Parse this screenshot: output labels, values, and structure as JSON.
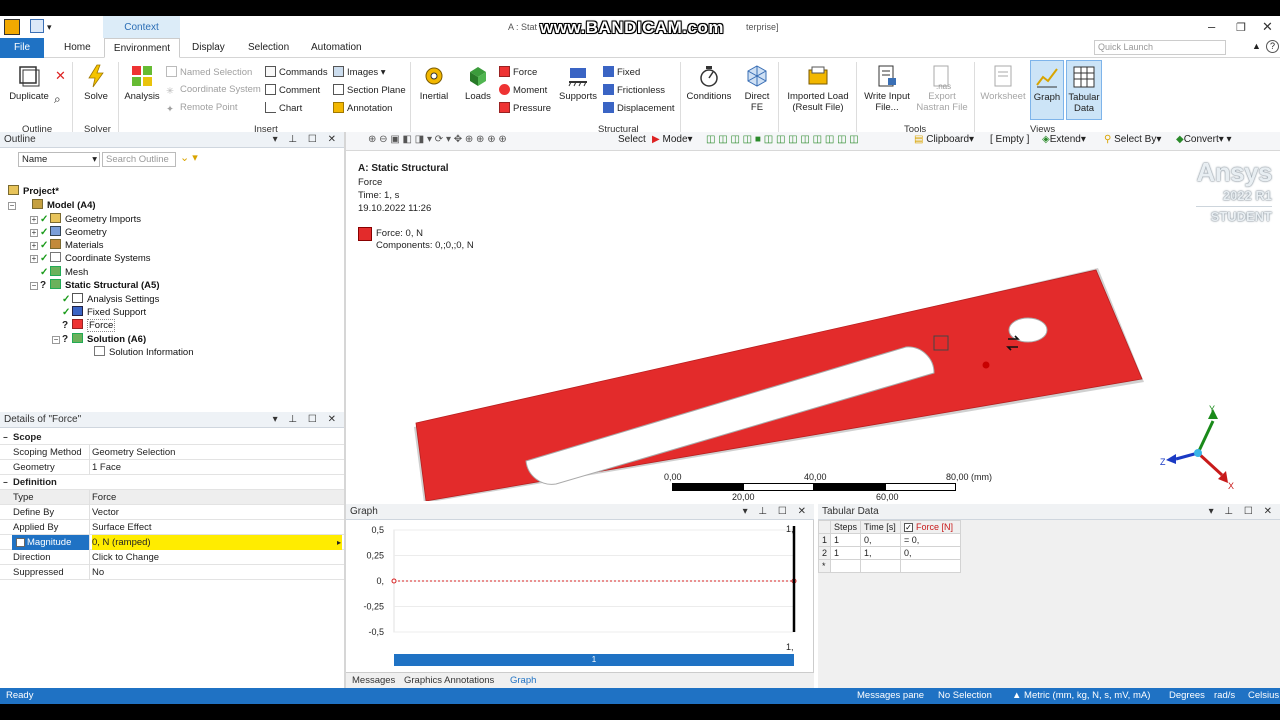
{
  "window": {
    "title": "A : Stat",
    "title_tail": "terprise]",
    "watermark": "www.BANDICAM.com",
    "context_tab": "Context",
    "controls": [
      "–",
      "❐",
      "✕"
    ]
  },
  "menu": {
    "tabs": [
      "File",
      "Home",
      "Environment",
      "Display",
      "Selection",
      "Automation"
    ],
    "active": "Environment",
    "quick_launch_placeholder": "Quick Launch",
    "help": "?"
  },
  "ribbon": {
    "duplicate": "Duplicate",
    "solve": "Solve",
    "analysis": "Analysis",
    "named_selection": "Named Selection",
    "coordinate_system": "Coordinate System",
    "remote_point": "Remote Point",
    "commands": "Commands",
    "comment": "Comment",
    "chart": "Chart",
    "images": "Images",
    "section_plane": "Section Plane",
    "annotation": "Annotation",
    "inertial": "Inertial",
    "loads": "Loads",
    "force": "Force",
    "moment": "Moment",
    "pressure": "Pressure",
    "supports": "Supports",
    "fixed": "Fixed",
    "frictionless": "Frictionless",
    "displacement": "Displacement",
    "conditions": "Conditions",
    "direct_fe_1": "Direct",
    "direct_fe_2": "FE",
    "imported_load_1": "Imported Load",
    "imported_load_2": "(Result File)",
    "write_input_1": "Write Input",
    "write_input_2": "File...",
    "export_nastran_1": "Export",
    "export_nastran_2": "Nastran File",
    "nas_label": ".nas",
    "worksheet": "Worksheet",
    "graph": "Graph",
    "tabular_1": "Tabular",
    "tabular_2": "Data",
    "groups": {
      "outline": "Outline",
      "solver": "Solver",
      "insert": "Insert",
      "structural": "Structural",
      "tools": "Tools",
      "views": "Views"
    }
  },
  "outline": {
    "header": "Outline",
    "filter_name": "Name",
    "search_placeholder": "Search Outline",
    "tree": [
      {
        "label": "Project*"
      },
      {
        "label": "Model (A4)"
      },
      {
        "label": "Geometry Imports"
      },
      {
        "label": "Geometry"
      },
      {
        "label": "Materials"
      },
      {
        "label": "Coordinate Systems"
      },
      {
        "label": "Mesh"
      },
      {
        "label": "Static Structural (A5)"
      },
      {
        "label": "Analysis Settings"
      },
      {
        "label": "Fixed Support"
      },
      {
        "label": "Force"
      },
      {
        "label": "Solution (A6)"
      },
      {
        "label": "Solution Information"
      }
    ]
  },
  "details": {
    "header": "Details of \"Force\"",
    "rows": [
      {
        "key": "Scope",
        "value": ""
      },
      {
        "key": "Scoping Method",
        "value": "Geometry Selection"
      },
      {
        "key": "Geometry",
        "value": "1 Face"
      },
      {
        "key": "Definition",
        "value": ""
      },
      {
        "key": "Type",
        "value": "Force"
      },
      {
        "key": "Define By",
        "value": "Vector"
      },
      {
        "key": "Applied By",
        "value": "Surface Effect"
      },
      {
        "key": "Magnitude",
        "value": "0, N  (ramped)"
      },
      {
        "key": "Direction",
        "value": "Click to Change"
      },
      {
        "key": "Suppressed",
        "value": "No"
      }
    ]
  },
  "viewport_toolbar": {
    "select": "Select",
    "mode": "Mode",
    "clipboard": "Clipboard",
    "empty": "[ Empty ]",
    "extend": "Extend",
    "select_by": "Select By",
    "convert": "Convert"
  },
  "viewport": {
    "analysis": "A: Static Structural",
    "object": "Force",
    "time": "Time: 1, s",
    "date": "19.10.2022 11:26",
    "legend_label": "Force: 0, N",
    "legend_components": "Components: 0,;0,;0, N",
    "legend_color": "#e32b2b",
    "brand": "Ansys",
    "version": "2022 R1",
    "edition": "STUDENT",
    "scale": {
      "labels_top": [
        "0,00",
        "40,00",
        "80,00 (mm)"
      ],
      "labels_bottom": [
        "20,00",
        "60,00"
      ]
    },
    "triad": {
      "x": "X",
      "y": "Y",
      "z": "Z"
    }
  },
  "graph": {
    "header": "Graph",
    "corner_top": "1,",
    "corner_bottom": "1,",
    "timeline_label": "1",
    "chart_data": {
      "type": "line",
      "y_ticks": [
        "0,5",
        "0,25",
        "0,",
        "-0,25",
        "-0,5"
      ],
      "ylim": [
        -0.5,
        0.5
      ],
      "xlim": [
        0,
        1
      ],
      "series": [
        {
          "x": [
            0,
            1
          ],
          "values": [
            0,
            0
          ]
        }
      ]
    }
  },
  "tabular": {
    "header": "Tabular Data",
    "columns": [
      "Steps",
      "Time [s]",
      "Force [N]"
    ],
    "rows": [
      {
        "idx": "1",
        "steps": "1",
        "time": "0,",
        "force": "= 0,"
      },
      {
        "idx": "2",
        "steps": "1",
        "time": "1,",
        "force": "0,"
      },
      {
        "idx": "*",
        "steps": "",
        "time": "",
        "force": ""
      }
    ]
  },
  "bottom_tabs": [
    "Messages",
    "Graphics Annotations",
    "Graph"
  ],
  "status": {
    "ready": "Ready",
    "messages_pane": "Messages pane",
    "no_selection": "No Selection",
    "units": "Metric (mm, kg, N, s, mV, mA)",
    "degrees": "Degrees",
    "rads": "rad/s",
    "celsius": "Celsius"
  },
  "colors": {
    "accent": "#1f72c4",
    "body_red": "#e32b2b",
    "highlight": "#ffec00"
  }
}
